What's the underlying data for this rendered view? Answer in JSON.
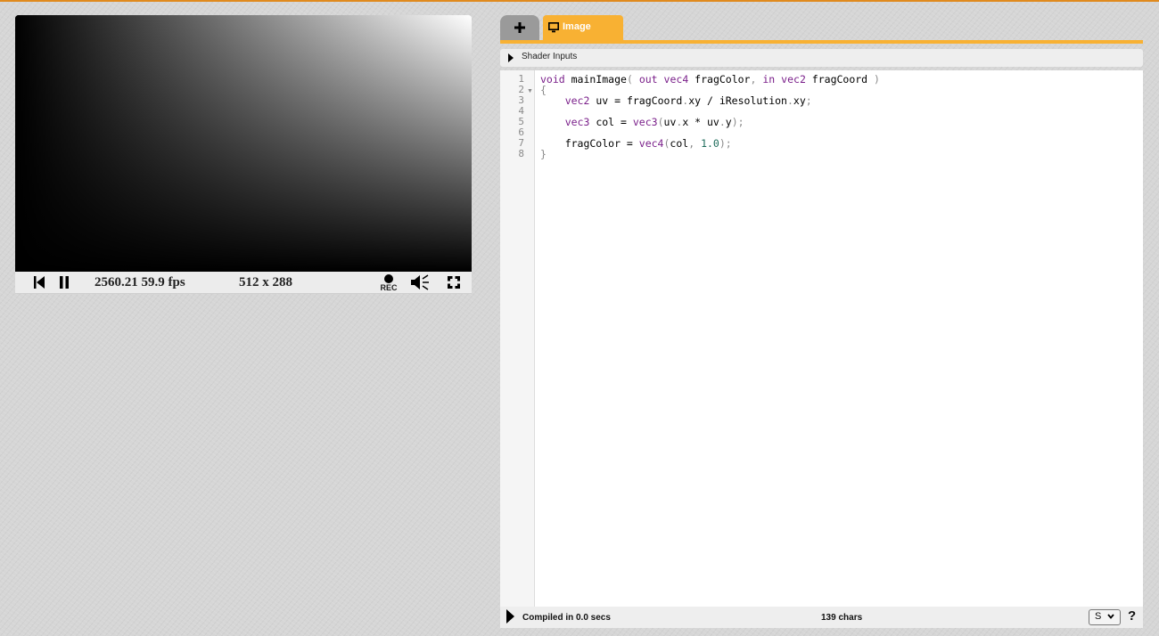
{
  "theme": {
    "accent": "#f8b133",
    "top_border": "#e08a1e"
  },
  "player": {
    "time_fps": "2560.21 59.9 fps",
    "resolution": "512 x 288",
    "rec_label": "REC",
    "icons": [
      "rewind-icon",
      "pause-icon",
      "record-icon",
      "volume-icon",
      "fullscreen-icon"
    ]
  },
  "editor": {
    "tabs": [
      {
        "label": "+",
        "icon": "plus-icon"
      },
      {
        "label": "Image",
        "icon": "monitor-icon",
        "active": true
      }
    ],
    "shader_inputs_label": "Shader Inputs",
    "line_numbers": [
      "1",
      "2",
      "3",
      "4",
      "5",
      "6",
      "7",
      "8"
    ],
    "code_lines": [
      "void mainImage( out vec4 fragColor, in vec2 fragCoord )",
      "{",
      "    vec2 uv = fragCoord.xy / iResolution.xy;",
      "",
      "    vec3 col = vec3(uv.x * uv.y);",
      "",
      "    fragColor = vec4(col, 1.0);",
      "}"
    ],
    "status": {
      "compile": "Compiled in 0.0 secs",
      "chars": "139 chars",
      "mode": "S",
      "help": "?"
    }
  }
}
